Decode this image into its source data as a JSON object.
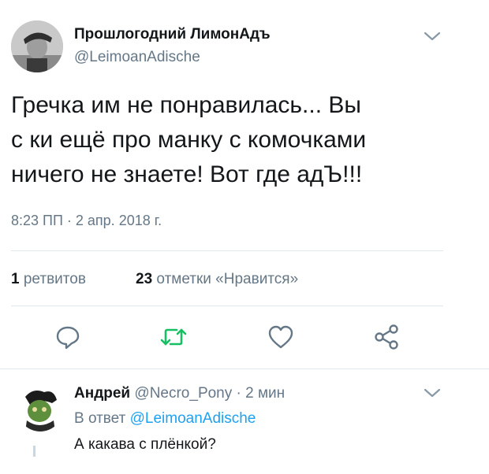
{
  "tweet": {
    "author_name": "Прошлогодний ЛимонАдъ",
    "author_handle": "@LeimoanAdische",
    "text_lines": [
      "Гречка им не понравилась... Вы",
      "с  ки ещё про манку с комочками",
      "ничего не знаете! Вот где адЪ!!!"
    ],
    "timestamp": "8:23 ПП · 2 апр. 2018 г.",
    "retweets_count": "1",
    "retweets_label": "ретвитов",
    "likes_count": "23",
    "likes_label": "отметки «Нравится»",
    "icons": [
      "reply-icon",
      "retweet-icon",
      "like-icon",
      "share-icon",
      "chevron-down-icon"
    ]
  },
  "reply": {
    "author_name": "Андрей",
    "meta": "@Necro_Pony · 2 мин",
    "reply_to_prefix": "В ответ",
    "reply_to_handle": "@LeimoanAdische",
    "text": "А какава с плёнкой?"
  },
  "colors": {
    "text": "#14171a",
    "secondary": "#657786",
    "link": "#1da1f2",
    "retweet": "#17bf63",
    "divider": "#e1e8ed"
  }
}
